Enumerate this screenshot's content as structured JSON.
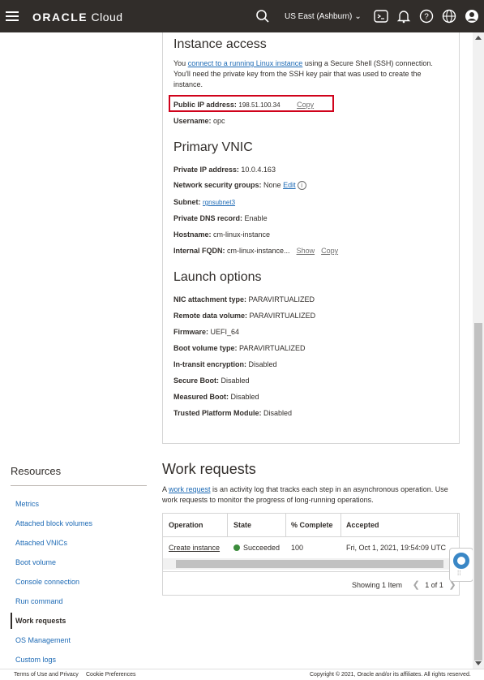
{
  "header": {
    "brand_bold": "ORACLE",
    "brand_rest": "Cloud",
    "region": "US East (Ashburn)"
  },
  "instance_access": {
    "title": "Instance access",
    "desc_prefix": "You ",
    "desc_link": "connect to a running Linux instance",
    "desc_suffix": " using a Secure Shell (SSH) connection. You'll need the private key from the SSH key pair that was used to create the instance.",
    "public_ip_label": "Public IP address:",
    "public_ip_value": "198.51.100.34",
    "copy_label": "Copy",
    "username_label": "Username:",
    "username_value": "opc"
  },
  "primary_vnic": {
    "title": "Primary VNIC",
    "private_ip_label": "Private IP address:",
    "private_ip_value": "10.0.4.163",
    "nsg_label": "Network security groups:",
    "nsg_value": "None",
    "nsg_edit": "Edit",
    "subnet_label": "Subnet:",
    "subnet_value": "rgnsubnet3",
    "dns_label": "Private DNS record:",
    "dns_value": "Enable",
    "hostname_label": "Hostname:",
    "hostname_value": "cm-linux-instance",
    "fqdn_label": "Internal FQDN:",
    "fqdn_value": "cm-linux-instance...",
    "show_label": "Show",
    "copy_label": "Copy"
  },
  "launch_options": {
    "title": "Launch options",
    "items": [
      {
        "label": "NIC attachment type:",
        "value": "PARAVIRTUALIZED"
      },
      {
        "label": "Remote data volume:",
        "value": "PARAVIRTUALIZED"
      },
      {
        "label": "Firmware:",
        "value": "UEFI_64"
      },
      {
        "label": "Boot volume type:",
        "value": "PARAVIRTUALIZED"
      },
      {
        "label": "In-transit encryption:",
        "value": "Disabled"
      },
      {
        "label": "Secure Boot:",
        "value": "Disabled"
      },
      {
        "label": "Measured Boot:",
        "value": "Disabled"
      },
      {
        "label": "Trusted Platform Module:",
        "value": "Disabled"
      }
    ]
  },
  "resources": {
    "title": "Resources",
    "items": [
      {
        "label": "Metrics"
      },
      {
        "label": "Attached block volumes"
      },
      {
        "label": "Attached VNICs"
      },
      {
        "label": "Boot volume"
      },
      {
        "label": "Console connection"
      },
      {
        "label": "Run command"
      },
      {
        "label": "Work requests"
      },
      {
        "label": "OS Management"
      },
      {
        "label": "Custom logs"
      }
    ]
  },
  "work_requests": {
    "title": "Work requests",
    "desc_prefix": "A ",
    "desc_link": "work request",
    "desc_suffix": " is an activity log that tracks each step in an asynchronous operation. Use work requests to monitor the progress of long-running operations.",
    "columns": [
      "Operation",
      "State",
      "% Complete",
      "Accepted"
    ],
    "rows": [
      {
        "operation": "Create instance",
        "state": "Succeeded",
        "complete": "100",
        "accepted": "Fri, Oct 1, 2021, 19:54:09 UTC"
      }
    ],
    "showing": "Showing 1 Item",
    "page": "1 of 1",
    "colors": {
      "success": "#3b8c3b"
    }
  },
  "footer": {
    "terms": "Terms of Use and Privacy",
    "cookies": "Cookie Preferences",
    "copyright": "Copyright © 2021, Oracle and/or its affiliates. All rights reserved."
  }
}
